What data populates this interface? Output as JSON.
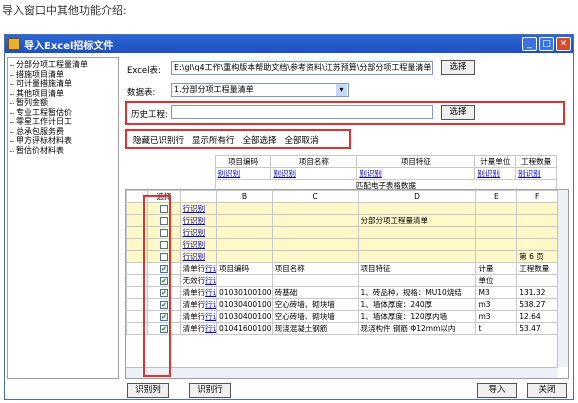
{
  "intro": "导入窗口中其他功能介绍:",
  "window": {
    "title": "导入Excel招标文件"
  },
  "tree": [
    "分部分项工程量清单",
    "措施项目清单",
    "可计量措施清单",
    "其他项目清单",
    "暂列金额",
    "专业工程暂估价",
    "零星工作计日工",
    "总承包服务费",
    "甲方评标材料表",
    "暂估价材料表"
  ],
  "form": {
    "excel_label": "Excel表:",
    "excel_path": "E:\\gl\\q4工作\\重构版本帮助文档\\参考资料\\江苏预算\\分部分项工程量清单",
    "browse_label": "选择",
    "sheet_label": "数据表:",
    "sheet_value": "1.分部分项工程量清单",
    "history_label": "历史工程:",
    "history_value": "",
    "history_button": "选择"
  },
  "toolbar": [
    "隐藏已识别行",
    "显示所有行",
    "全部选择",
    "全部取消"
  ],
  "grid": {
    "map_headers": [
      "项目编码",
      "项目名称",
      "项目特征",
      "计量单位",
      "工程数量"
    ],
    "map_links": [
      "别识别",
      "别识别",
      "别识别",
      "别识别",
      "别识别"
    ],
    "match_caption": "匹配电子表格数据",
    "select_header": "选择",
    "letter_headers": [
      "B",
      "C",
      "D",
      "E",
      "F"
    ],
    "rows": [
      {
        "checked": false,
        "type": "",
        "link": "行识别",
        "b": "",
        "c": "",
        "d": "",
        "e": "",
        "f": ""
      },
      {
        "checked": false,
        "type": "",
        "link": "行识别",
        "b": "",
        "c": "",
        "d": "分部分项工程量清单",
        "e": "",
        "f": ""
      },
      {
        "checked": false,
        "type": "",
        "link": "行识别",
        "b": "",
        "c": "",
        "d": "",
        "e": "",
        "f": ""
      },
      {
        "checked": false,
        "type": "",
        "link": "行识别",
        "b": "",
        "c": "",
        "d": "",
        "e": "",
        "f": ""
      },
      {
        "checked": false,
        "type": "",
        "link": "行识别",
        "b": "",
        "c": "",
        "d": "",
        "e": "",
        "f": "第 6 页"
      },
      {
        "checked": true,
        "type": "清单行",
        "link": "行识别",
        "b": "项目编码",
        "c": "项目名称",
        "d": "项目特征",
        "e": "计量",
        "f": "工程数量"
      },
      {
        "checked": true,
        "type": "无效行",
        "link": "行识别",
        "b": "",
        "c": "",
        "d": "",
        "e": "单位",
        "f": ""
      },
      {
        "checked": true,
        "type": "清单行",
        "link": "行识别",
        "b": "010301001001",
        "c": "砖基础",
        "d": "1、砖品种，规格：MU10烧结",
        "e": "M3",
        "f": "131.32"
      },
      {
        "checked": true,
        "type": "清单行",
        "link": "行识别",
        "b": "010304001001",
        "c": "空心砖墙、砌块墙",
        "d": "1、墙体厚度：240厚",
        "e": "m3",
        "f": "538.27"
      },
      {
        "checked": true,
        "type": "清单行",
        "link": "行识别",
        "b": "010304001002",
        "c": "空心砖墙、砌块墙",
        "d": "1、墙体厚度：120厚内墙",
        "e": "m3",
        "f": "12.64"
      },
      {
        "checked": true,
        "type": "清单行",
        "link": "行识别",
        "b": "010416001001",
        "c": "现浇混凝土钢筋",
        "d": "现浇构件 钢筋 Φ12mm以内",
        "e": "t",
        "f": "53.47"
      }
    ]
  },
  "footer": {
    "col_recog": "识别列",
    "row_recog": "识别行",
    "import": "导入",
    "close": "关闭"
  }
}
